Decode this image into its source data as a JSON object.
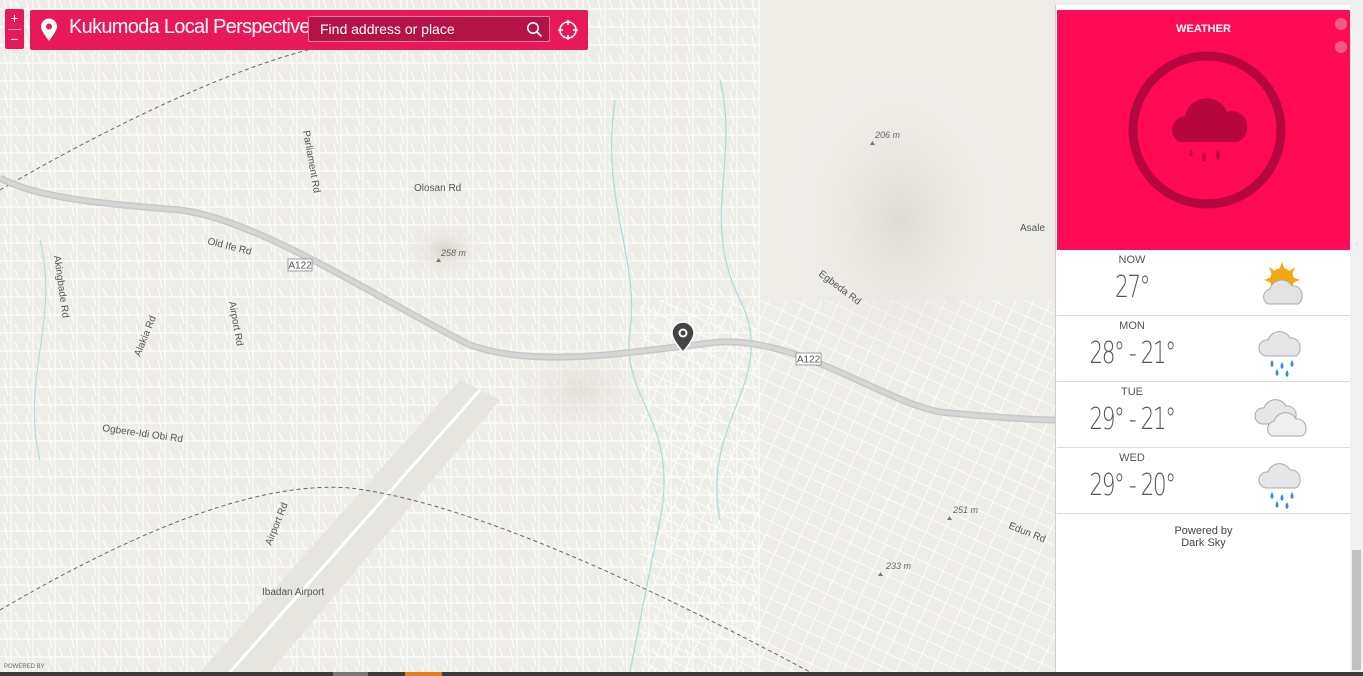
{
  "app": {
    "title": "Kukumoda Local Perspective"
  },
  "zoom": {
    "in_label": "+",
    "out_label": "−"
  },
  "search": {
    "placeholder": "Find address or place"
  },
  "map": {
    "roads": {
      "a122_label": "A122",
      "olosan": "Olosan Rd",
      "old_ife": "Old Ife Rd",
      "parliament": "Parliament Rd",
      "akingbade": "Akingbade Rd",
      "alakia": "Alakia Rd",
      "airport_rd": "Airport Rd",
      "ogbere": "Ogbere-Idi Obi Rd",
      "egbeda": "Egbeda Rd",
      "edun": "Edun Rd"
    },
    "places": {
      "asale": "Asale",
      "airport": "Ibadan Airport"
    },
    "elevations": {
      "e258": "258 m",
      "e206": "206 m",
      "e251": "251 m",
      "e233": "233 m"
    },
    "attribution": "POWERED BY"
  },
  "weather": {
    "title": "WEATHER",
    "current_condition_icon": "rain-cloud-icon",
    "accent_color": "#ff0a55",
    "forecast": [
      {
        "day": "NOW",
        "temp": "27°",
        "icon": "partly-sunny-icon"
      },
      {
        "day": "MON",
        "temp": "28° - 21°",
        "icon": "rain-icon"
      },
      {
        "day": "TUE",
        "temp": "29° - 21°",
        "icon": "cloudy-icon"
      },
      {
        "day": "WED",
        "temp": "29° - 20°",
        "icon": "rain-icon"
      }
    ],
    "powered_line1": "Powered by",
    "powered_line2": "Dark Sky"
  }
}
